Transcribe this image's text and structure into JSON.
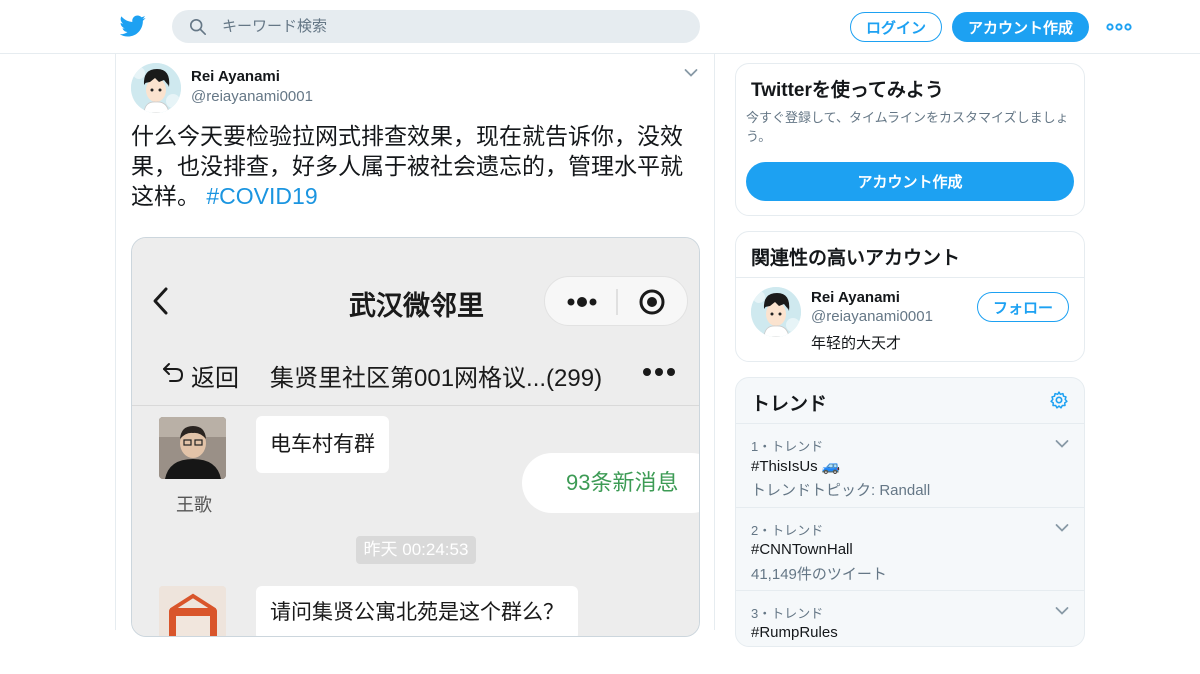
{
  "topbar": {
    "search_placeholder": "キーワード検索",
    "login_label": "ログイン",
    "signup_label": "アカウント作成"
  },
  "tweet": {
    "author_name": "Rei Ayanami",
    "author_handle": "@reiayanami0001",
    "text": "什么今天要检验拉网式排查效果，现在就告诉你，没效果，也没排查，好多人属于被社会遗忘的，管理水平就这样。",
    "hashtag": "#COVID19"
  },
  "media": {
    "title": "武汉微邻里",
    "return_label": "返回",
    "group_name": "集贤里社区第001网格议...(299)",
    "msg1_text": "电车村有群",
    "msg1_sender": "王歌",
    "new_messages": "93条新消息",
    "timestamp": "昨天 00:24:53",
    "msg2_text": "请问集贤公寓北苑是这个群么？"
  },
  "sidebar": {
    "try_title": "Twitterを使ってみよう",
    "try_desc": "今すぐ登録して、タイムラインをカスタマイズしましょう。",
    "try_button": "アカウント作成",
    "related_title": "関連性の高いアカウント",
    "related_name": "Rei Ayanami",
    "related_handle": "@reiayanami0001",
    "related_bio": "年轻的大天才",
    "follow_label": "フォロー",
    "trends_title": "トレンド",
    "trends": [
      {
        "meta": "1・トレンド",
        "name": "#ThisIsUs 🚙",
        "sub": "トレンドトピック: Randall"
      },
      {
        "meta": "2・トレンド",
        "name": "#CNNTownHall",
        "sub": "41,149件のツイート"
      },
      {
        "meta": "3・トレンド",
        "name": "#RumpRules",
        "sub": ""
      }
    ]
  },
  "colors": {
    "brand": "#1da1f2",
    "link": "#1b95e0",
    "muted": "#657786",
    "wechat_green": "#3d9b55"
  }
}
